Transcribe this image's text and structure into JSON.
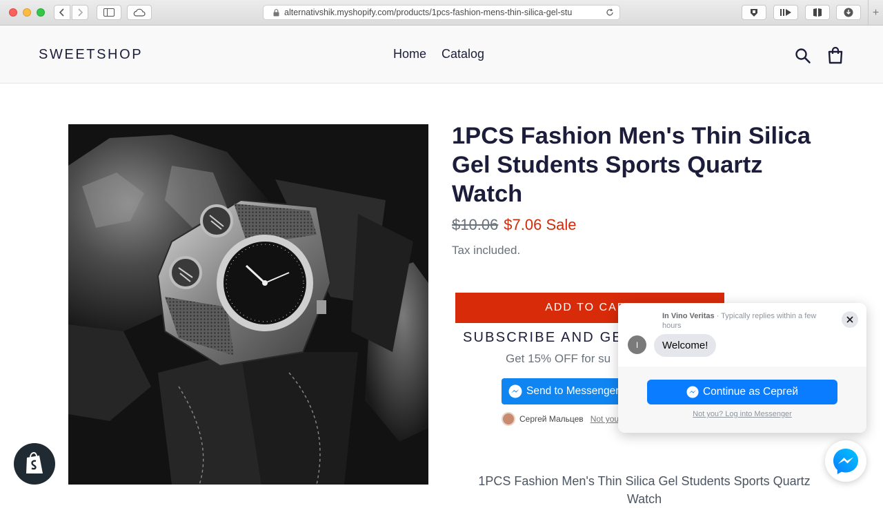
{
  "browser": {
    "url": "alternativshik.myshopify.com/products/1pcs-fashion-mens-thin-silica-gel-stu",
    "new_tab": "+"
  },
  "header": {
    "logo": "SWEETSHOP",
    "nav": [
      {
        "label": "Home"
      },
      {
        "label": "Catalog"
      }
    ],
    "icons": [
      "search-icon",
      "cart-icon"
    ]
  },
  "product": {
    "title": "1PCS Fashion Men's Thin Silica Gel Students Sports Quartz Watch",
    "price_original": "$10.06",
    "price_sale": "$7.06 Sale",
    "tax_note": "Tax included.",
    "add_to_cart": "ADD TO CART",
    "subscribe_heading": "SUBSCRIBE AND GE",
    "subscribe_sub": "Get 15% OFF for su",
    "send_to_messenger": "Send to Messenger",
    "user_name": "Сергей Мальцев",
    "not_you_short": "Not you",
    "description": "1PCS Fashion Men's Thin Silica Gel Students Sports Quartz Watch"
  },
  "chat": {
    "page_name": "In Vino Veritas",
    "reply_time": " · Typically replies within a few hours",
    "avatar_letter": "I",
    "message": "Welcome!",
    "continue_label": "Continue as Сергей",
    "login_link": "Not you? Log into Messenger"
  },
  "colors": {
    "brand_text": "#1c1d3a",
    "sale_red": "#d12a0b",
    "cart_button": "#d72b0a",
    "messenger_blue": "#0a7cff"
  }
}
